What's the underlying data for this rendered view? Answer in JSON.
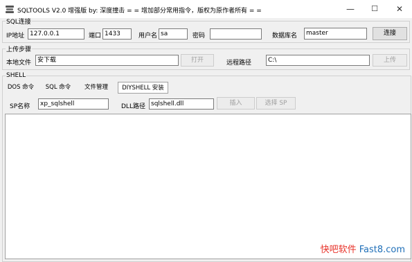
{
  "window": {
    "title": "SQLTOOLS V2.0 增强版   by: 深度撞击    = = 增加部分常用指令，版权为原作者所有 = =",
    "minimize": "—",
    "maximize": "☐",
    "close": "✕"
  },
  "sql_group": {
    "legend": "SQL连接",
    "ip_label": "IP地址",
    "ip_value": "127.0.0.1",
    "port_label": "端口",
    "port_value": "1433",
    "user_label": "用户名",
    "user_value": "sa",
    "password_label": "密码",
    "password_value": "",
    "db_label": "数据库名",
    "db_value": "master",
    "connect_button": "连接"
  },
  "upload_group": {
    "legend": "上传步骤",
    "local_label": "本地文件",
    "local_value": "安下载",
    "open_button": "打开",
    "remote_label": "远程路径",
    "remote_value": "C:\\",
    "upload_button": "上传"
  },
  "shell_group": {
    "legend": "SHELL",
    "tabs": [
      {
        "label": "DOS 命令"
      },
      {
        "label": "SQL 命令"
      },
      {
        "label": "文件管理"
      },
      {
        "label": "DIYSHELL 安装"
      }
    ],
    "sp_label": "SP名称",
    "sp_value": "xp_sqlshell",
    "dll_label": "DLL路径",
    "dll_value": "sqlshell.dll",
    "insert_button": "插入",
    "select_sp_button": "选择 SP"
  },
  "watermark": {
    "part1": "快吧软件 ",
    "part2": "Fast8.com"
  }
}
